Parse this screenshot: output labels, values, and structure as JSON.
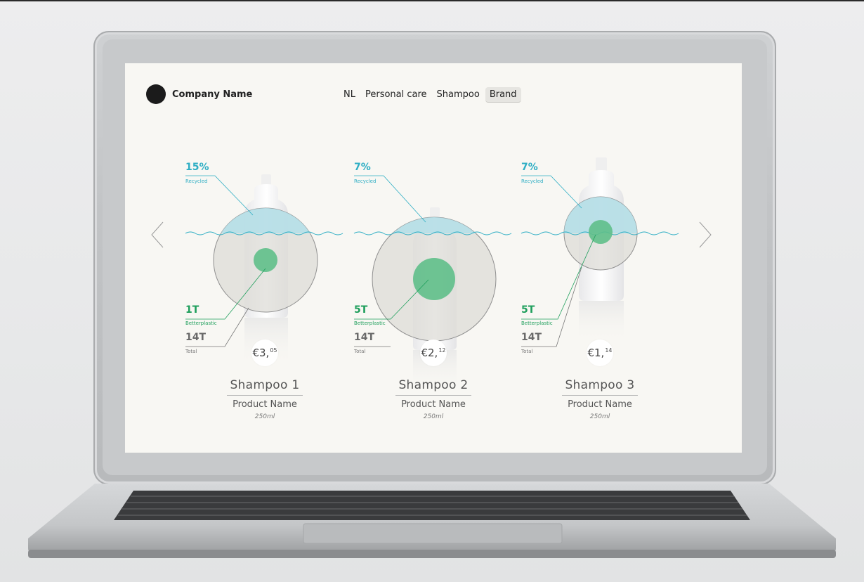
{
  "header": {
    "company_name": "Company Name",
    "breadcrumbs": [
      "NL",
      "Personal care",
      "Shampoo",
      "Brand"
    ]
  },
  "colors": {
    "recycled": "#2eaec4",
    "betterplastic": "#1f9f5c",
    "total": "#6a6a6a",
    "water": "#b8e0ea",
    "circle_fill": "#e2e0db"
  },
  "icons": {
    "prev": "chevron-left-icon",
    "next": "chevron-right-icon",
    "logo": "company-logo-circle"
  },
  "products": [
    {
      "category": "Shampoo 1",
      "name": "Product Name",
      "size": "250ml",
      "price_main": "€3,",
      "price_cents": "05",
      "recycled_value": "15%",
      "recycled_label": "Recycled",
      "betterplastic_value": "1T",
      "betterplastic_label": "Betterplastic",
      "total_value": "14T",
      "total_label": "Total"
    },
    {
      "category": "Shampoo 2",
      "name": "Product Name",
      "size": "250ml",
      "price_main": "€2,",
      "price_cents": "12",
      "recycled_value": "7%",
      "recycled_label": "Recycled",
      "betterplastic_value": "5T",
      "betterplastic_label": "Betterplastic",
      "total_value": "14T",
      "total_label": "Total"
    },
    {
      "category": "Shampoo 3",
      "name": "Product Name",
      "size": "250ml",
      "price_main": "€1,",
      "price_cents": "14",
      "recycled_value": "7%",
      "recycled_label": "Recycled",
      "betterplastic_value": "5T",
      "betterplastic_label": "Betterplastic",
      "total_value": "14T",
      "total_label": "Total"
    }
  ]
}
